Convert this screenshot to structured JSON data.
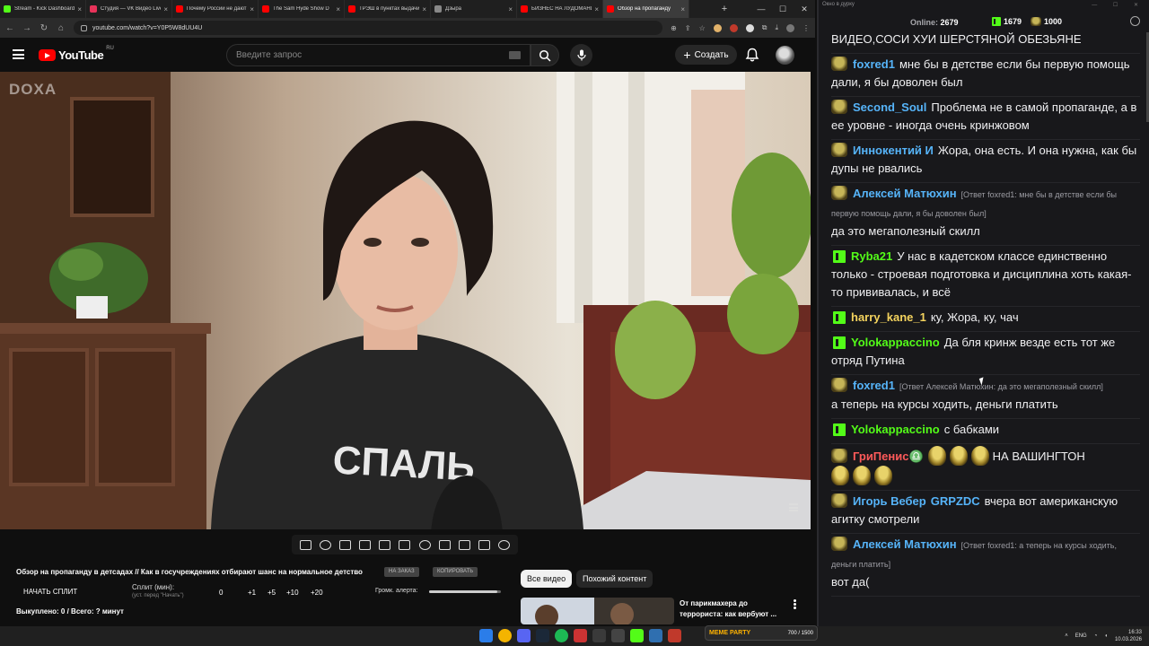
{
  "browser": {
    "tabs": [
      {
        "label": "Stream - Kick Dashboard",
        "color": "#53fc18",
        "active": false
      },
      {
        "label": "Студия — VK Видео Live",
        "color": "#e8335a",
        "active": false
      },
      {
        "label": "Почему России не дают",
        "color": "#ff0000",
        "active": false
      },
      {
        "label": "The Sam Hyde Show D",
        "color": "#ff0000",
        "active": false
      },
      {
        "label": "ТРЭШ в пунктах выдачи",
        "color": "#ff0000",
        "active": false
      },
      {
        "label": "Дзыра",
        "color": "#888888",
        "active": false
      },
      {
        "label": "БИЗНЕС НА ЛУДОМАНИИ",
        "color": "#ff0000",
        "active": false
      },
      {
        "label": "Обзор на пропаганду",
        "color": "#ff0000",
        "active": true
      }
    ],
    "url": "youtube.com/watch?v=Y0P5W8dUU4U"
  },
  "youtube": {
    "logo_text": "YouTube",
    "logo_region": "RU",
    "search_placeholder": "Введите запрос",
    "create_label": "Создать",
    "video_watermark": "DOXA"
  },
  "below_video": {
    "title": "Обзор на пропаганду в детсадах // Как в госучреждениях отбирают шанс на нормальное детство",
    "tag1": "НА ЗАКАЗ",
    "tag2": "КОПИРОВАТЬ",
    "split_button": "НАЧАТЬ СПЛИТ",
    "split_label": "Сплит (мин):",
    "split_sub": "(уст. перед \"Начать\")",
    "split_values": [
      "0",
      "+1",
      "+5",
      "+10",
      "+20"
    ],
    "alert_label": "Громк. алерта:",
    "alert_volume": 0.95,
    "bought": "Выкуплено: 0 / Всего: ? минут",
    "chip_all": "Все видео",
    "chip_related": "Похожий контент",
    "rec_title": "От парикмахера до террориста: как вербуют ..."
  },
  "chat": {
    "window_title": "Окно в дурку",
    "online_label": "Online:",
    "online_count": "2679",
    "kick_count": "1679",
    "other_count": "1000",
    "messages": [
      {
        "badge": "",
        "user": "",
        "color": "#ffffff",
        "reply": "",
        "text": "ВИДЕО,СОСИ ХУИ ШЕРСТЯНОЙ ОБЕЗЬЯНЕ"
      },
      {
        "badge": "pepe",
        "user": "foxred1",
        "color": "#56b4f9",
        "reply": "",
        "text": "мне бы в детстве если бы первую помощь дали, я бы доволен был"
      },
      {
        "badge": "pepe",
        "user": "Second_Soul",
        "color": "#56b4f9",
        "reply": "",
        "text": "Проблема не в самой пропаганде, а в ее уровне - иногда очень кринжовом"
      },
      {
        "badge": "pepe",
        "user": "Иннокентий И",
        "color": "#56b4f9",
        "reply": "",
        "text": "Жора, она есть. И она нужна, как бы дупы не рвались"
      },
      {
        "badge": "pepe",
        "user": "Алексей Матюхин",
        "color": "#56b4f9",
        "reply": "[Ответ foxred1: мне бы в детстве если бы первую помощь дали, я бы доволен был]",
        "text": "да это мегаполезный скилл"
      },
      {
        "badge": "kick",
        "user": "Ryba21",
        "color": "#53fc18",
        "reply": "",
        "text": "У нас в кадетском классе единственно только - строевая подготовка и дисциплина хоть какая-то прививалась, и всё"
      },
      {
        "badge": "kick",
        "user": "harry_kane_1",
        "color": "#f4d35e",
        "reply": "",
        "text": "ку, Жора, ку, чач"
      },
      {
        "badge": "kick",
        "user": "Yolokappaccino",
        "color": "#53fc18",
        "reply": "",
        "text": "Да бля кринж везде есть тот же отряд Путина"
      },
      {
        "badge": "pepe",
        "user": "foxred1",
        "color": "#56b4f9",
        "reply": "[Ответ Алексей Матюхин: да это мегаполезный скилл]",
        "text": "а теперь на курсы ходить, деньги платить"
      },
      {
        "badge": "kick",
        "user": "Yolokappaccino",
        "color": "#53fc18",
        "reply": "",
        "text": "с бабками"
      },
      {
        "badge": "pepe",
        "user": "ГриПенис♎",
        "color": "#ff5a5a",
        "reply": "",
        "text": "НА ВАШИНГТОН",
        "emotes": 6
      },
      {
        "badge": "pepe",
        "user": "Игорь Вебер",
        "color": "#56b4f9",
        "user2": "GRPZDC",
        "reply": "",
        "text": "вчера вот американскую агитку смотрели"
      },
      {
        "badge": "pepe",
        "user": "Алексей Матюхин",
        "color": "#56b4f9",
        "reply": "[Ответ foxred1: а теперь на курсы ходить, деньги платить]",
        "text": "вот да("
      }
    ]
  },
  "taskbar": {
    "memeparty_label": "MEME PARTY",
    "memeparty_value": "700 / 1500",
    "lang": "ENG",
    "time": "16:33",
    "date": "10.03.2026"
  }
}
